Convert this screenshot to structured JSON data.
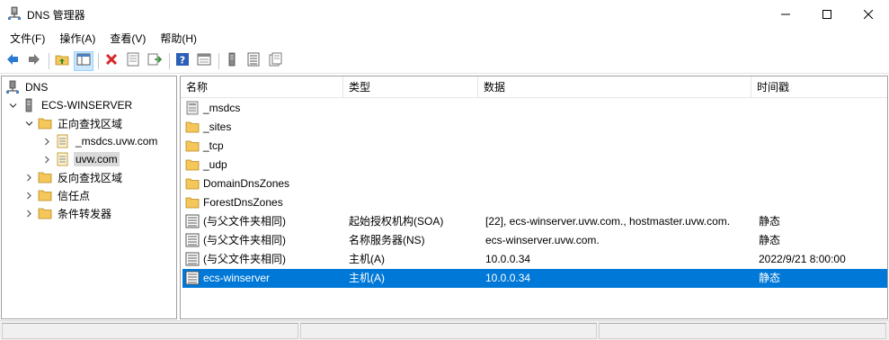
{
  "window": {
    "title": "DNS 管理器",
    "app_icon": "dns-server-icon",
    "controls": [
      "minimize-icon",
      "maximize-icon",
      "close-icon"
    ]
  },
  "menu": {
    "items": [
      {
        "label": "文件(F)"
      },
      {
        "label": "操作(A)"
      },
      {
        "label": "查看(V)"
      },
      {
        "label": "帮助(H)"
      }
    ]
  },
  "toolbar": {
    "buttons": [
      "back-arrow-icon",
      "forward-arrow-icon",
      "up-folder-icon",
      "show-hide-tree-icon",
      "delete-icon",
      "properties-icon",
      "export-list-icon",
      "help-icon",
      "show-console-icon",
      "server-icon",
      "list-icon",
      "refresh-icon"
    ]
  },
  "tree": {
    "items": [
      {
        "label": "DNS",
        "level": 0,
        "expanded": null,
        "icon": "dns-root-icon"
      },
      {
        "label": "ECS-WINSERVER",
        "level": 1,
        "expanded": true,
        "icon": "server-icon"
      },
      {
        "label": "正向查找区域",
        "level": 2,
        "expanded": true,
        "icon": "folder-icon"
      },
      {
        "label": "_msdcs.uvw.com",
        "level": 3,
        "expanded": false,
        "icon": "zone-icon"
      },
      {
        "label": "uvw.com",
        "level": 3,
        "expanded": false,
        "icon": "zone-icon",
        "selected": true
      },
      {
        "label": "反向查找区域",
        "level": 2,
        "expanded": false,
        "icon": "folder-icon"
      },
      {
        "label": "信任点",
        "level": 2,
        "expanded": false,
        "icon": "folder-icon"
      },
      {
        "label": "条件转发器",
        "level": 2,
        "expanded": false,
        "icon": "folder-icon"
      }
    ]
  },
  "list": {
    "columns": [
      "名称",
      "类型",
      "数据",
      "时间戳"
    ],
    "rows": [
      {
        "name": "_msdcs",
        "type": "",
        "data": "",
        "timestamp": "",
        "icon": "delegated-zone-icon"
      },
      {
        "name": "_sites",
        "type": "",
        "data": "",
        "timestamp": "",
        "icon": "folder-icon"
      },
      {
        "name": "_tcp",
        "type": "",
        "data": "",
        "timestamp": "",
        "icon": "folder-icon"
      },
      {
        "name": "_udp",
        "type": "",
        "data": "",
        "timestamp": "",
        "icon": "folder-icon"
      },
      {
        "name": "DomainDnsZones",
        "type": "",
        "data": "",
        "timestamp": "",
        "icon": "folder-icon"
      },
      {
        "name": "ForestDnsZones",
        "type": "",
        "data": "",
        "timestamp": "",
        "icon": "folder-icon"
      },
      {
        "name": "(与父文件夹相同)",
        "type": "起始授权机构(SOA)",
        "data": "[22], ecs-winserver.uvw.com., hostmaster.uvw.com.",
        "timestamp": "静态",
        "icon": "record-icon"
      },
      {
        "name": "(与父文件夹相同)",
        "type": "名称服务器(NS)",
        "data": "ecs-winserver.uvw.com.",
        "timestamp": "静态",
        "icon": "record-icon"
      },
      {
        "name": "(与父文件夹相同)",
        "type": "主机(A)",
        "data": "10.0.0.34",
        "timestamp": "2022/9/21 8:00:00",
        "icon": "record-icon"
      },
      {
        "name": "ecs-winserver",
        "type": "主机(A)",
        "data": "10.0.0.34",
        "timestamp": "静态",
        "icon": "record-icon",
        "selected": true
      }
    ]
  },
  "colors": {
    "selection": "#0078d7",
    "folder": "#f5c75a",
    "toolbar_active": "#cce8ff",
    "delete_red": "#d8262b",
    "nav_blue": "#2b79d1"
  }
}
